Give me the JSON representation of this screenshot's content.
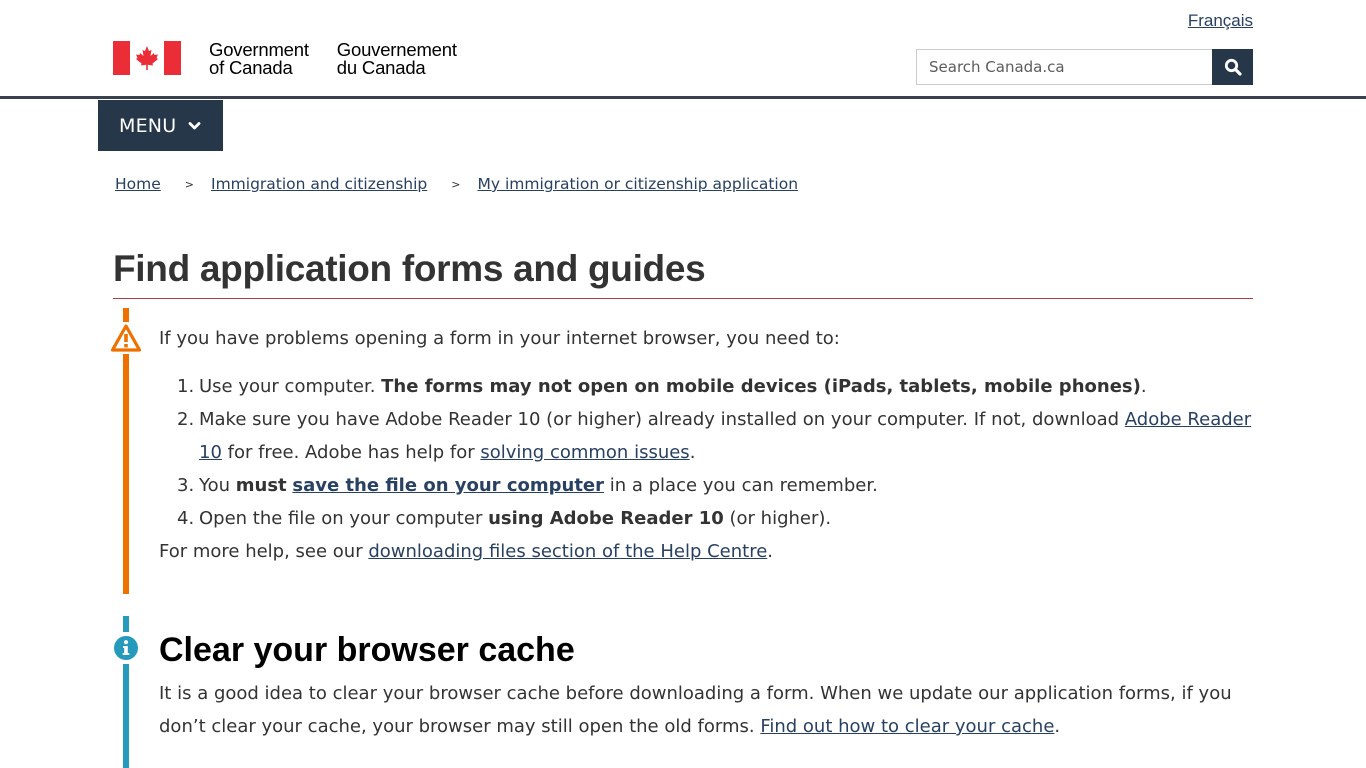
{
  "header": {
    "language_link": "Français",
    "signature": {
      "en_line1": "Government",
      "en_line2": "of Canada",
      "fr_line1": "Gouvernement",
      "fr_line2": "du Canada"
    },
    "search": {
      "placeholder": "Search Canada.ca",
      "button_icon": "search-icon"
    },
    "menu_label": "MENU"
  },
  "colors": {
    "brand_dark": "#26374a",
    "link": "#284162",
    "flag_red": "#eb2d37",
    "title_rule": "#af3c43",
    "warning": "#ee7100",
    "info": "#269abc"
  },
  "breadcrumb": [
    {
      "label": "Home"
    },
    {
      "label": "Immigration and citizenship"
    },
    {
      "label": "My immigration or citizenship application"
    }
  ],
  "breadcrumb_separator": ">",
  "page_title": "Find application forms and guides",
  "warning_alert": {
    "icon": "warning-triangle-icon",
    "intro": "If you have problems opening a form in your internet browser, you need to:",
    "steps": [
      {
        "text": "Use your computer. ",
        "bold": "The forms may not open on mobile devices (iPads, tablets, mobile phones)",
        "after": "."
      },
      {
        "text": "Make sure you have Adobe Reader 10 (or higher) already installed on your computer. If not, download ",
        "link1": "Adobe Reader 10",
        "middle": " for free. Adobe has help for ",
        "link2": "solving common issues",
        "after": "."
      },
      {
        "text": "You ",
        "bold": "must",
        "space": " ",
        "link": "save the file on your computer",
        "after": " in a place you can remember."
      },
      {
        "text": "Open the file on your computer ",
        "bold": "using Adobe Reader 10",
        "after": " (or higher)."
      }
    ],
    "footer_text": "For more help, see our ",
    "footer_link": "downloading files section of the Help Centre",
    "footer_after": "."
  },
  "info_alert": {
    "icon": "info-icon",
    "heading": "Clear your browser cache",
    "text": "It is a good idea to clear your browser cache before downloading a form. When we update our application forms, if you don’t clear your cache, your browser may still open the old forms. ",
    "link": "Find out how to clear your cache",
    "after": "."
  }
}
